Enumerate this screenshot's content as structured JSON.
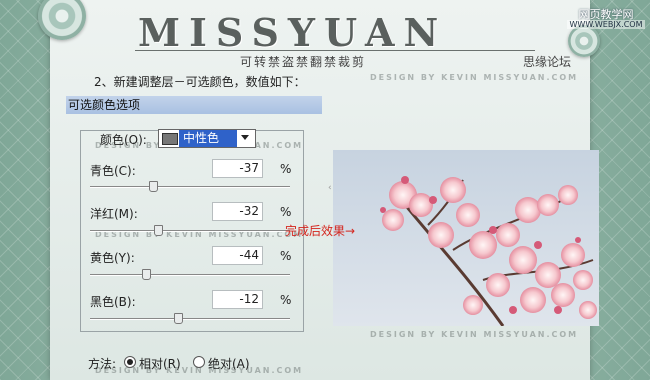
{
  "header": {
    "title": "MISSYUAN",
    "subtitle": "可转禁盗禁翻禁裁剪",
    "forum": "思缘论坛",
    "watermark_top": "网页教学网",
    "watermark_url": "WWW.WEBJX.COM"
  },
  "step_text": "2、新建调整层－可选颜色，数值如下：",
  "watermark_text": "DESIGN BY KEVIN MISSYUAN.COM",
  "dialog": {
    "title": "可选颜色选项",
    "color_label": "颜色(O):",
    "color_value": "中性色",
    "rows": [
      {
        "label": "青色(C):",
        "value": "-37",
        "unit": "%",
        "slider_fraction": 0.315
      },
      {
        "label": "洋红(M):",
        "value": "-32",
        "unit": "%",
        "slider_fraction": 0.34
      },
      {
        "label": "黄色(Y):",
        "value": "-44",
        "unit": "%",
        "slider_fraction": 0.28
      },
      {
        "label": "黑色(B):",
        "value": "-12",
        "unit": "%",
        "slider_fraction": 0.44
      }
    ],
    "method_label": "方法:",
    "method_relative": "相对(R)",
    "method_absolute": "绝对(A)",
    "method_selected": "relative"
  },
  "caption": "完成后效果→",
  "colors": {
    "select_highlight": "#2f62c9",
    "caption": "#d4261e",
    "panel_title_bg": "#b3c8e6"
  }
}
